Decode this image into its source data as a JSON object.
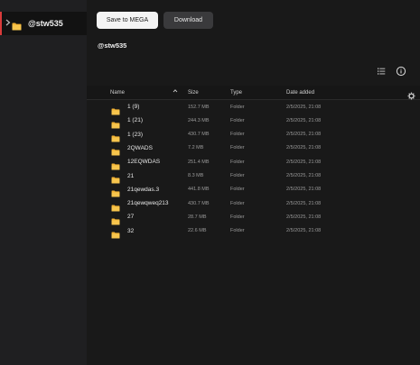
{
  "sidebar": {
    "items": [
      {
        "label": "@stw535",
        "icon": "folder-icon",
        "selected": true
      }
    ]
  },
  "toolbar": {
    "save_label": "Save to MEGA",
    "download_label": "Download"
  },
  "breadcrumb": {
    "title": "@stw535"
  },
  "table": {
    "columns": [
      "Name",
      "Size",
      "Type",
      "Date added"
    ],
    "sort": {
      "column": "Name",
      "direction": "ascending"
    },
    "rows": [
      {
        "name": "1 (9)",
        "size": "152.7 MB",
        "type": "Folder",
        "date": "2/5/2025, 21:08"
      },
      {
        "name": "1 (21)",
        "size": "244.3 MB",
        "type": "Folder",
        "date": "2/5/2025, 21:08"
      },
      {
        "name": "1 (23)",
        "size": "430.7 MB",
        "type": "Folder",
        "date": "2/5/2025, 21:08"
      },
      {
        "name": "2QWADS",
        "size": "7.2 MB",
        "type": "Folder",
        "date": "2/5/2025, 21:08"
      },
      {
        "name": "12EQWDAS",
        "size": "251.4 MB",
        "type": "Folder",
        "date": "2/5/2025, 21:08"
      },
      {
        "name": "21",
        "size": "8.3 MB",
        "type": "Folder",
        "date": "2/5/2025, 21:08"
      },
      {
        "name": "21qewdas.3",
        "size": "441.8 MB",
        "type": "Folder",
        "date": "2/5/2025, 21:08"
      },
      {
        "name": "21qewqweq213",
        "size": "430.7 MB",
        "type": "Folder",
        "date": "2/5/2025, 21:08"
      },
      {
        "name": "27",
        "size": "28.7 MB",
        "type": "Folder",
        "date": "2/5/2025, 21:08"
      },
      {
        "name": "32",
        "size": "22.6 MB",
        "type": "Folder",
        "date": "2/5/2025, 21:08"
      }
    ]
  },
  "colors": {
    "accent": "#d93b3b",
    "folder": "#f2b233",
    "background": "#191919",
    "sidebar": "#1f1f21"
  }
}
